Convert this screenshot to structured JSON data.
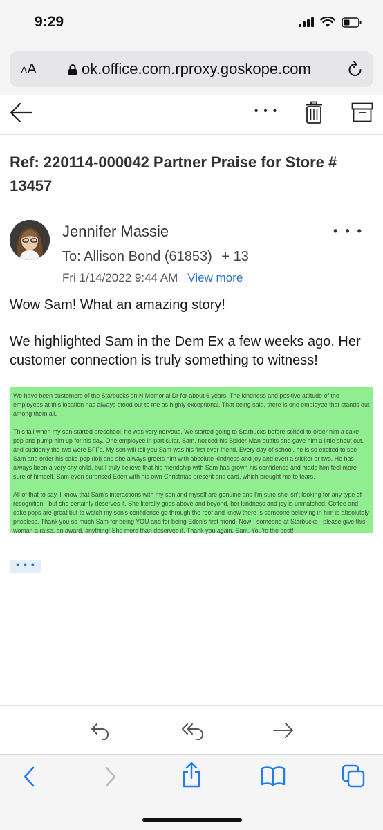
{
  "status": {
    "time": "9:29"
  },
  "browser": {
    "aa_label_small": "A",
    "aa_label_large": "A",
    "url": "ok.office.com.rproxy.goskope.com"
  },
  "toolbar": {
    "more_label": "• • •"
  },
  "email": {
    "subject": "Ref: 220114-000042 Partner Praise for Store # 13457",
    "sender": "Jennifer Massie",
    "more_label": "• • •",
    "to_label": "To:",
    "to_name": "Allison Bond (61853)",
    "to_extra": "+ 13",
    "date": "Fri 1/14/2022 9:44 AM",
    "view_more": "View more",
    "line1": "Wow Sam! What an amazing story!",
    "line2": "We highlighted Sam in the Dem Ex a few weeks ago. Her customer connection is truly something to witness!",
    "quoted": {
      "p1": "We have been customers of the Starbucks on N Memorial Dr for about 6 years. The kindness and positive attitude of the employees at this location has always stood out to me as highly exceptional. That being said, there is one employee that stands out among them all.",
      "p2": "This fall when my son started preschool, he was very nervous. We started going to Starbucks before school to order him a cake pop and pump him up for his day. One employee in particular, Sam, noticed his Spider-Man outfits and gave him a little shout out, and suddenly the two were BFFs. My son will tell you Sam was his first ever friend. Every day of school, he is so excited to see Sam and order his cake pop (lol) and she always greets him with absolute kindness and joy and even a sticker or two. He has always been a very shy child, but I truly believe that his friendship with Sam has grown his confidence and made him feel more sure of himself. Sam even surprised Eden with his own Christmas present and card, which brought me to tears.",
      "p3": "All of that to say, I know that Sam's interactions with my son and myself are genuine and I'm sure she isn't looking for any type of recognition - but she certainly deserves it. She literally goes above and beyond, her kindness and joy is unmatched. Coffee and cake pops are great but to watch my son's confidence go through the roof and know there is someone believing in him is absolutely priceless. Thank you so much Sam for being YOU and for being Eden's first friend. Now - someone at Starbucks - please give this woman a raise, an award, anything! She more than deserves it. Thank you again, Sam. You're the best!"
    },
    "expand_label": "• • •"
  },
  "colors": {
    "accent": "#2a72c9",
    "quote_bg": "#90ee90",
    "safari_blue": "#1f7cf2"
  }
}
